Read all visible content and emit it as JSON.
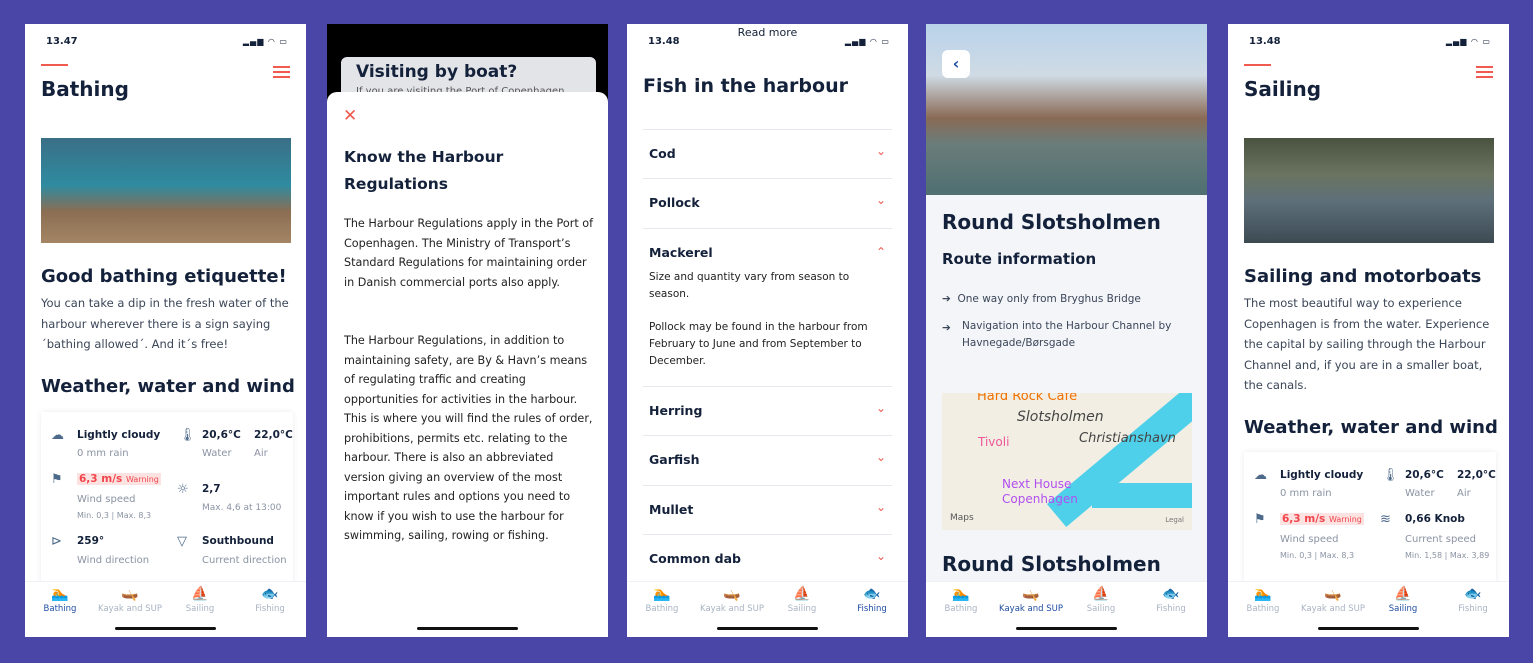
{
  "colors": {
    "background": "#4a46a8",
    "accent": "#f05a4f",
    "active_tab": "#1f4ea3",
    "warning": "#f0454a"
  },
  "tabs": [
    "Bathing",
    "Kayak and SUP",
    "Sailing",
    "Fishing"
  ],
  "tab_icons": [
    "swimmer-icon",
    "kayak-icon",
    "sailboat-icon",
    "fish-icon"
  ],
  "screen1": {
    "time": "13.47",
    "title": "Bathing",
    "heading": "Good bathing etiquette!",
    "body": "You can take a dip in the fresh water of the harbour wherever there is a sign saying ´bathing allowed´. And it´s free!",
    "weather_title": "Weather, water and wind",
    "weather": {
      "sky": "Lightly cloudy",
      "rain": "0 mm rain",
      "water_temp": "20,6°C",
      "water_label": "Water",
      "air_temp": "22,0°C",
      "air_label": "Air",
      "wind": "6,3 m/s",
      "warning": "Warning",
      "wind_label": "Wind speed",
      "wind_min": "Min. 0,3",
      "wind_max": "Max. 8,3",
      "uv": "2,7",
      "uv_max": "Max. 4,6 at 13:00",
      "wind_dir": "259°",
      "wind_dir_label": "Wind direction",
      "current_dir": "Southbound",
      "current_dir_label": "Current direction"
    },
    "active_tab": "Bathing"
  },
  "screen2": {
    "behind_title": "Visiting by boat?",
    "behind_text": "If you are visiting the Port of Copenhagen",
    "title": "Know the Harbour Regulations",
    "p1": "The Harbour Regulations apply in the Port of Copenhagen. The Ministry of Transport’s Standard Regulations for maintaining order in Danish commercial ports also apply.",
    "p2": "The Harbour Regulations, in addition to maintaining safety, are By & Havn’s means of regulating traffic and creating opportunities for activities in the harbour. This is where you will find the rules of order, prohibitions, permits etc. relating to the harbour. There is also an abbreviated version giving an overview of the most important rules and options you need to know if you wish to use the harbour for swimming, sailing, rowing or fishing."
  },
  "screen3": {
    "read_more": "Read more",
    "time": "13.48",
    "title": "Fish in the harbour",
    "fish": [
      "Cod",
      "Pollock",
      "Mackerel",
      "Herring",
      "Garfish",
      "Mullet",
      "Common dab"
    ],
    "expanded_p1": "Size and quantity vary from season to season.",
    "expanded_p2": "Pollock may be found in the harbour from February to June and from September to December.",
    "active_tab": "Fishing"
  },
  "screen4": {
    "title": "Round Slotsholmen",
    "subtitle": "Route information",
    "bullets": [
      "One way only from Bryghus Bridge",
      "Navigation into the Harbour Channel by Havnegade/Børsgade"
    ],
    "map_labels": [
      "Hard Rock Cafe",
      "Slotsholmen",
      "Christianshavn",
      "Tivoli",
      "Next House Copenhagen",
      "Maps",
      "Legal"
    ],
    "title2": "Round Slotsholmen",
    "active_tab": "Kayak and SUP"
  },
  "screen5": {
    "time": "13.48",
    "title": "Sailing",
    "heading": "Sailing and motorboats",
    "body": "The most beautiful way to experience Copenhagen is from the water. Experience the capital by sailing through the Harbour Channel and, if you are in a smaller boat, the canals.",
    "weather_title": "Weather, water and wind",
    "weather": {
      "sky": "Lightly cloudy",
      "rain": "0 mm rain",
      "water_temp": "20,6°C",
      "water_label": "Water",
      "air_temp": "22,0°C",
      "air_label": "Air",
      "wind": "6,3 m/s",
      "warning": "Warning",
      "wind_label": "Wind speed",
      "wind_min": "Min. 0,3",
      "wind_max": "Max. 8,3",
      "current": "0,66 Knob",
      "current_label": "Current speed",
      "current_min": "Min. 1,58",
      "current_max": "Max. 3,89"
    },
    "active_tab": "Sailing"
  }
}
